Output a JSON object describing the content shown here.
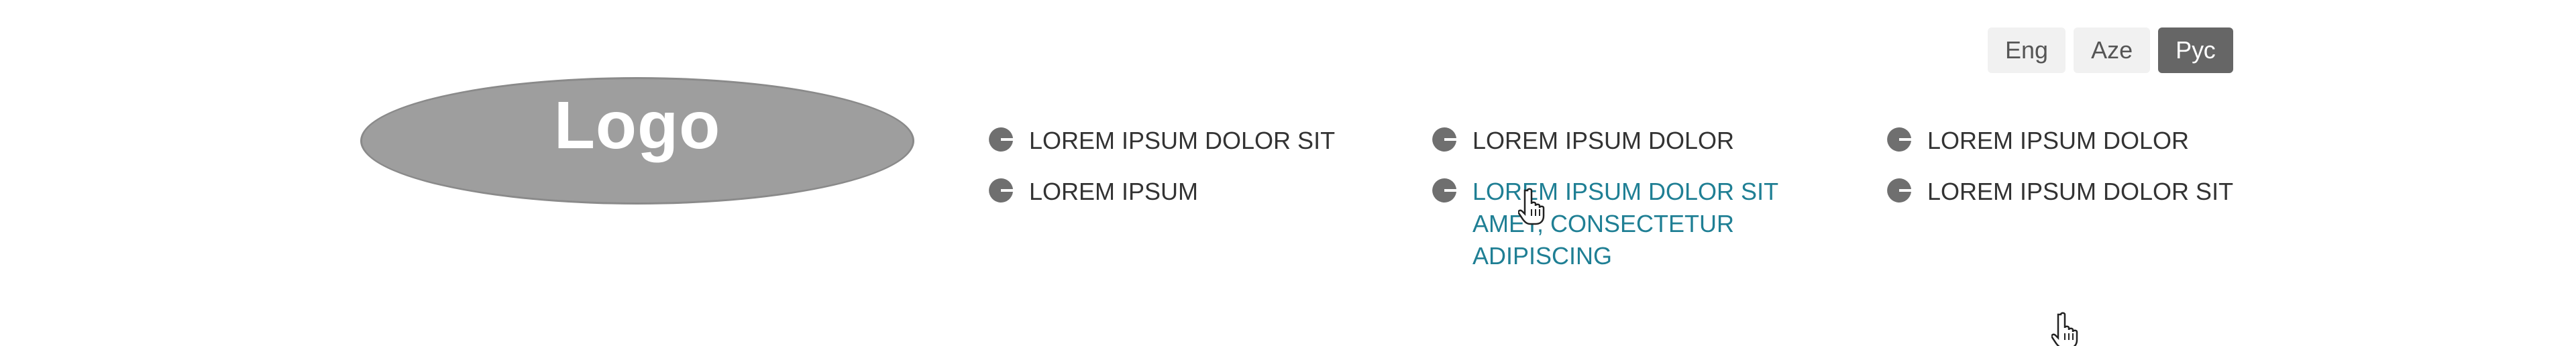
{
  "header": {
    "logo_text": "Logo",
    "languages": [
      {
        "label": "Eng",
        "active": false
      },
      {
        "label": "Aze",
        "active": false
      },
      {
        "label": "Рус",
        "active": true
      }
    ]
  },
  "nav": {
    "columns": [
      {
        "items": [
          {
            "label": "LOREM IPSUM DOLOR SIT"
          },
          {
            "label": "LOREM IPSUM"
          }
        ]
      },
      {
        "items": [
          {
            "label": "LOREM IPSUM DOLOR"
          },
          {
            "label": "LOREM IPSUM DOLOR SIT AMET, CONSECTETUR ADIPISCING",
            "hovered": true
          }
        ]
      },
      {
        "items": [
          {
            "label": "LOREM IPSUM DOLOR"
          },
          {
            "label": "LOREM IPSUM DOLOR SIT"
          }
        ]
      }
    ]
  },
  "colors": {
    "logo_bg": "#9e9e9e",
    "active_lang_bg": "#666666",
    "link_hover": "#1f7f94",
    "bullet": "#6f6f6f"
  },
  "icons": {
    "bullet": "half-circle-bullet-icon",
    "cursor": "hand-pointer-cursor-icon"
  }
}
